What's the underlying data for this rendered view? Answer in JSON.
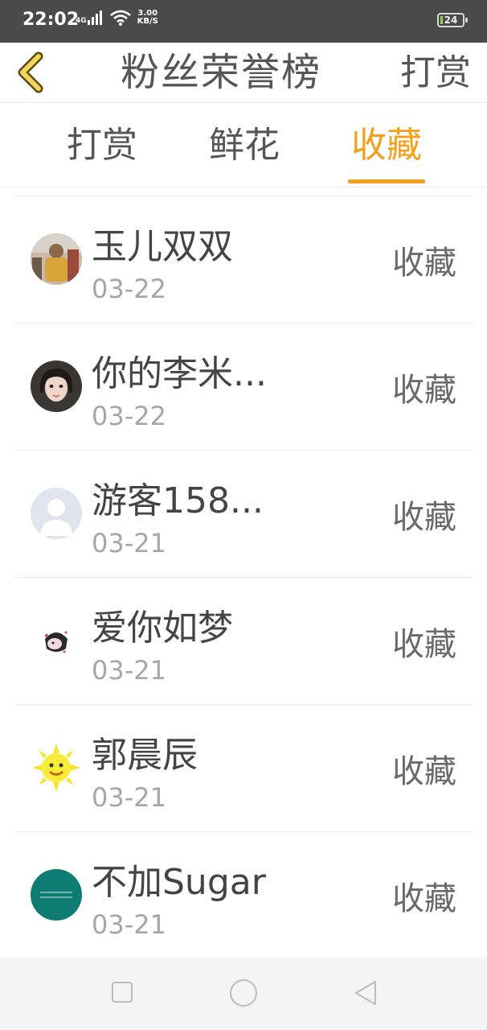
{
  "status_bar": {
    "time": "22:02",
    "network": "4G",
    "speed_value": "3.00",
    "speed_unit": "KB/S",
    "battery": "24"
  },
  "header": {
    "title": "粉丝荣誉榜",
    "right_action": "打赏",
    "back_icon": "chevron-left-icon"
  },
  "tabs": [
    {
      "label": "打赏",
      "active": false
    },
    {
      "label": "鲜花",
      "active": false
    },
    {
      "label": "收藏",
      "active": true
    }
  ],
  "colors": {
    "accent": "#f5a01a",
    "status_bar": "#4a4a4a",
    "text_primary": "#444444",
    "text_secondary": "#a6a6a6"
  },
  "fans": [
    {
      "name": "玉儿双双",
      "date": "03-22",
      "action": "收藏",
      "avatar": "photo-avatar"
    },
    {
      "name": "你的李米...",
      "date": "03-22",
      "action": "收藏",
      "avatar": "photo-avatar"
    },
    {
      "name": "游客158...",
      "date": "03-21",
      "action": "收藏",
      "avatar": "default-user-avatar"
    },
    {
      "name": "爱你如梦",
      "date": "03-21",
      "action": "收藏",
      "avatar": "photo-avatar"
    },
    {
      "name": "郭晨辰",
      "date": "03-21",
      "action": "收藏",
      "avatar": "sun-avatar"
    },
    {
      "name": "不加Sugar",
      "date": "03-21",
      "action": "收藏",
      "avatar": "teal-avatar"
    }
  ],
  "nav_bar": {
    "items": [
      "recent-apps-icon",
      "home-icon",
      "back-triangle-icon"
    ]
  }
}
